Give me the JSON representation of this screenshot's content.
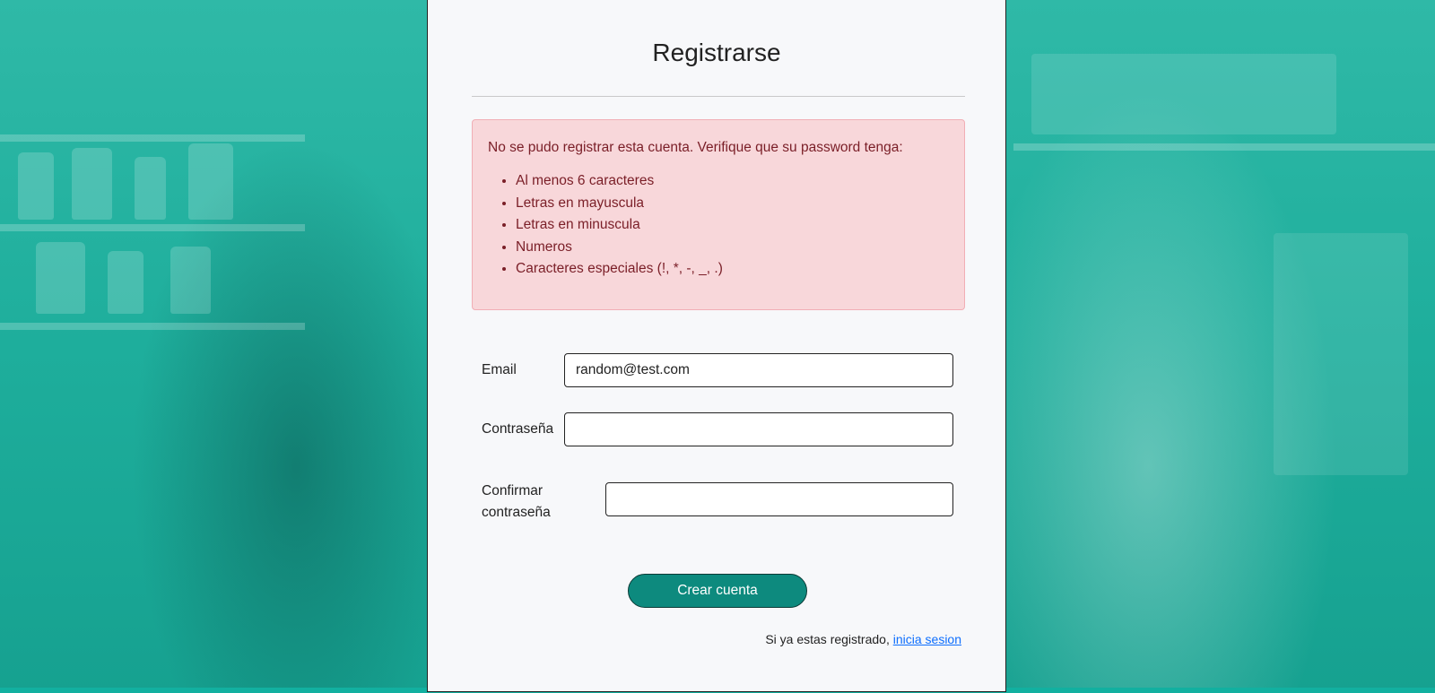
{
  "form": {
    "title": "Registrarse",
    "alert": {
      "message": "No se pudo registrar esta cuenta. Verifique que su password tenga:",
      "requirements": [
        "Al menos 6 caracteres",
        "Letras en mayuscula",
        "Letras en minuscula",
        "Numeros",
        "Caracteres especiales (!, *, -, _, .)"
      ]
    },
    "email": {
      "label": "Email",
      "value": "random@test.com"
    },
    "password": {
      "label": "Contraseña",
      "value": ""
    },
    "confirm_password": {
      "label_line1": "Confirmar",
      "label_line2": "contraseña",
      "value": ""
    },
    "submit_label": "Crear cuenta",
    "footer": {
      "text": "Si ya estas registrado, ",
      "link_text": "inicia sesion"
    }
  },
  "colors": {
    "background_teal": "#1aab9a",
    "card_bg": "#f7f8fa",
    "alert_bg": "#f8d7da",
    "alert_text": "#7a1e27",
    "button_bg": "#0d8a7e",
    "link": "#0d6efd"
  }
}
